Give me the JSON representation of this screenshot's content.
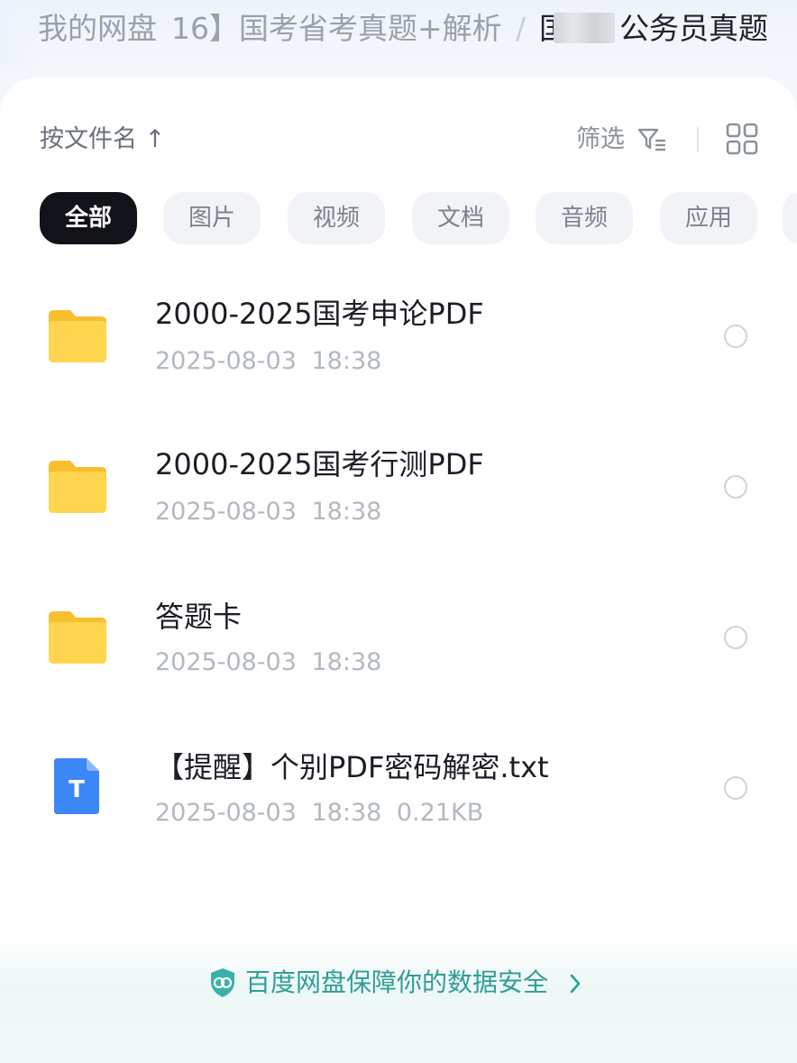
{
  "breadcrumb": {
    "root": "我的网盘",
    "middle": "16】国考省考真题+解析",
    "separator": "/",
    "current": "公务员真题",
    "current_prefix": "国"
  },
  "toolbar": {
    "sort_label": "按文件名 ↑",
    "filter_label": "筛选"
  },
  "filter_chips": [
    {
      "label": "全部",
      "active": true
    },
    {
      "label": "图片",
      "active": false
    },
    {
      "label": "视频",
      "active": false
    },
    {
      "label": "文档",
      "active": false
    },
    {
      "label": "音频",
      "active": false
    },
    {
      "label": "应用",
      "active": false
    }
  ],
  "files": [
    {
      "type": "folder",
      "name": "2000-2025国考申论PDF",
      "meta": "2025-08-03 18:38"
    },
    {
      "type": "folder",
      "name": "2000-2025国考行测PDF",
      "meta": "2025-08-03 18:38"
    },
    {
      "type": "folder",
      "name": "答题卡",
      "meta": "2025-08-03 18:38"
    },
    {
      "type": "txt",
      "name": "【提醒】个别PDF密码解密.txt",
      "meta": "2025-08-03 18:38 0.21KB",
      "icon_letter": "T"
    }
  ],
  "footer": {
    "security_text": "百度网盘保障你的数据安全"
  },
  "colors": {
    "folder": "#FFD24A",
    "txt_icon": "#3D86F5",
    "security": "#2E9E95",
    "active_chip": "#111319"
  }
}
